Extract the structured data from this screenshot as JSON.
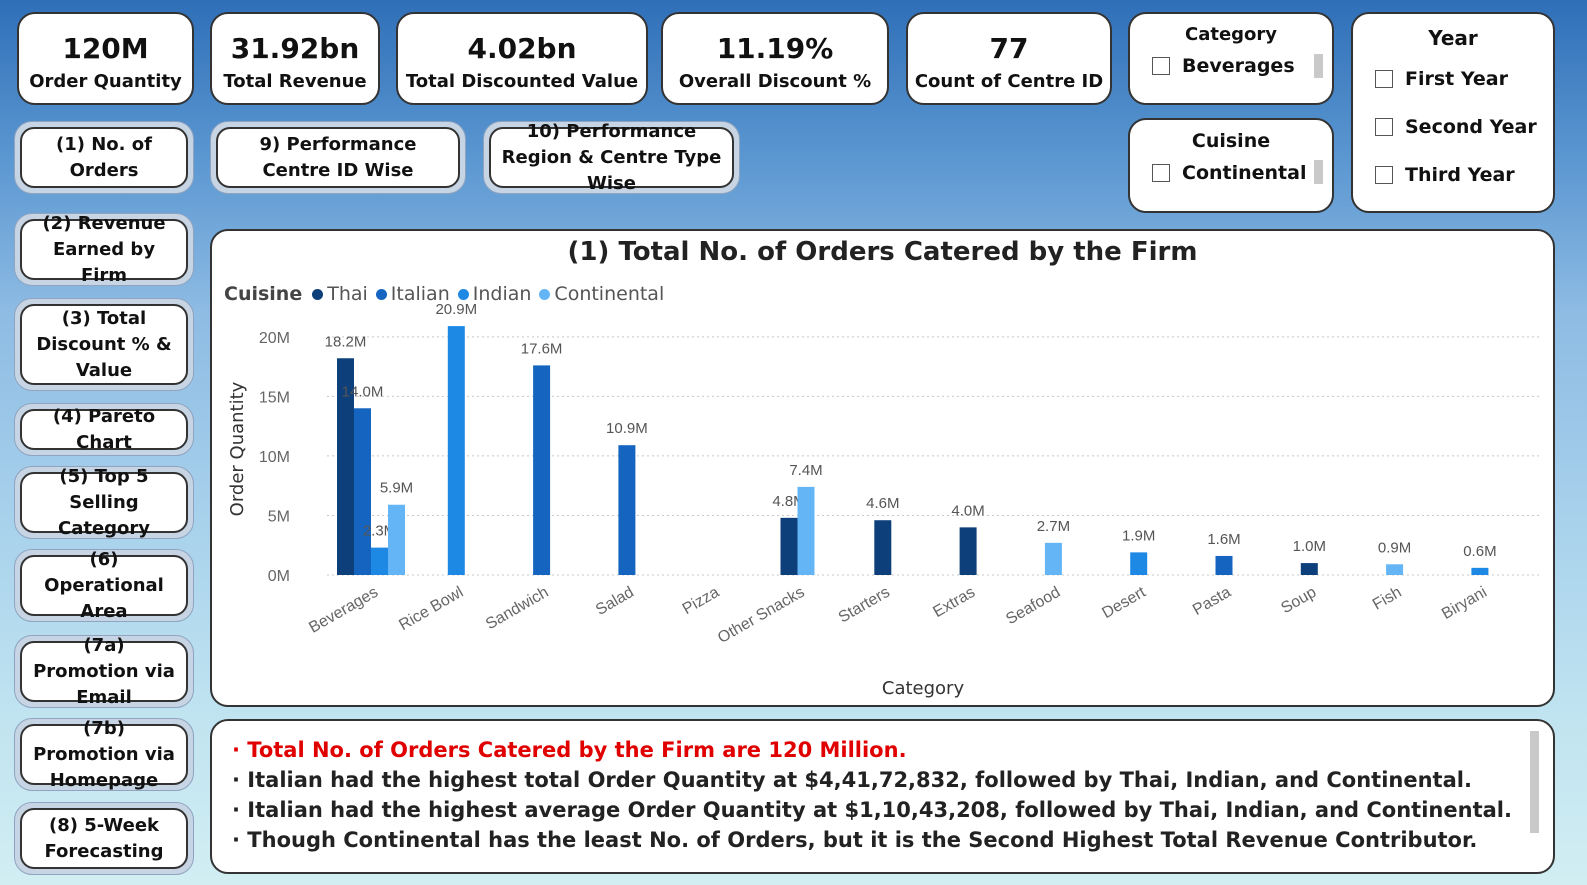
{
  "kpis": [
    {
      "value": "120M",
      "label": "Order Quantity"
    },
    {
      "value": "31.92bn",
      "label": "Total Revenue"
    },
    {
      "value": "4.02bn",
      "label": "Total Discounted Value"
    },
    {
      "value": "11.19%",
      "label": "Overall Discount %"
    },
    {
      "value": "77",
      "label": "Count of Centre ID"
    }
  ],
  "slicers": {
    "category": {
      "title": "Category",
      "selected_option": "Beverages"
    },
    "cuisine": {
      "title": "Cuisine",
      "selected_option": "Continental"
    },
    "year": {
      "title": "Year",
      "options": [
        "First Year",
        "Second Year",
        "Third Year"
      ]
    }
  },
  "nav_left": [
    "(1) No. of Orders",
    "(2) Revenue Earned by Firm",
    "(3) Total Discount % & Value",
    "(4) Pareto Chart",
    "(5) Top 5 Selling Category",
    "(6) Operational Area",
    "(7a) Promotion via Email",
    "(7b) Promotion via Homepage",
    "(8) 5-Week Forecasting"
  ],
  "nav_top": [
    "9) Performance Centre ID Wise",
    "10) Performance Region & Centre Type Wise"
  ],
  "chart_data": {
    "type": "bar",
    "title": "(1) Total No. of Orders Catered by the Firm",
    "xlabel": "Category",
    "ylabel": "Order Quantity",
    "legend_title": "Cuisine",
    "ylim": [
      0,
      22000000
    ],
    "yticks": [
      "0M",
      "5M",
      "10M",
      "15M",
      "20M"
    ],
    "ytick_values": [
      0,
      5000000,
      10000000,
      15000000,
      20000000
    ],
    "categories": [
      "Beverages",
      "Rice Bowl",
      "Sandwich",
      "Salad",
      "Pizza",
      "Other Snacks",
      "Starters",
      "Extras",
      "Seafood",
      "Desert",
      "Pasta",
      "Soup",
      "Fish",
      "Biryani"
    ],
    "series": [
      {
        "name": "Thai",
        "color": "#0d3f7a",
        "values": [
          18200000,
          null,
          null,
          null,
          null,
          4800000,
          4600000,
          4000000,
          null,
          null,
          null,
          1000000,
          null,
          null
        ],
        "labels": [
          "18.2M",
          "",
          "",
          "",
          "",
          "4.8M",
          "4.6M",
          "4.0M",
          "",
          "",
          "",
          "1.0M",
          "",
          ""
        ]
      },
      {
        "name": "Italian",
        "color": "#1565c0",
        "values": [
          14000000,
          null,
          17600000,
          10900000,
          null,
          null,
          null,
          null,
          null,
          null,
          1600000,
          null,
          null,
          null
        ],
        "labels": [
          "14.0M",
          "",
          "17.6M",
          "10.9M",
          "",
          "",
          "",
          "",
          "",
          "",
          "1.6M",
          "",
          "",
          ""
        ]
      },
      {
        "name": "Indian",
        "color": "#1e88e5",
        "values": [
          2300000,
          20900000,
          null,
          null,
          null,
          null,
          null,
          null,
          null,
          1900000,
          null,
          null,
          null,
          600000
        ],
        "labels": [
          "2.3M",
          "20.9M",
          "",
          "",
          "",
          "",
          "",
          "",
          "",
          "1.9M",
          "",
          "",
          "",
          "0.6M"
        ]
      },
      {
        "name": "Continental",
        "color": "#64b5f6",
        "values": [
          5900000,
          null,
          null,
          null,
          null,
          7400000,
          null,
          null,
          2700000,
          null,
          null,
          null,
          900000,
          null
        ],
        "labels": [
          "5.9M",
          "",
          "",
          "",
          "",
          "7.4M",
          "",
          "",
          "2.7M",
          "",
          "",
          "",
          "0.9M",
          ""
        ]
      }
    ]
  },
  "insights": [
    "Total No. of Orders Catered by the Firm are 120 Million.",
    "Italian had the highest total Order Quantity at $4,41,72,832, followed by Thai, Indian, and Continental.",
    " Italian had the highest average Order Quantity at $1,10,43,208, followed by Thai, Indian, and Continental.",
    "Though Continental has the least No. of Orders, but it is the Second Highest Total Revenue Contributor."
  ],
  "insight_bullet": "·"
}
